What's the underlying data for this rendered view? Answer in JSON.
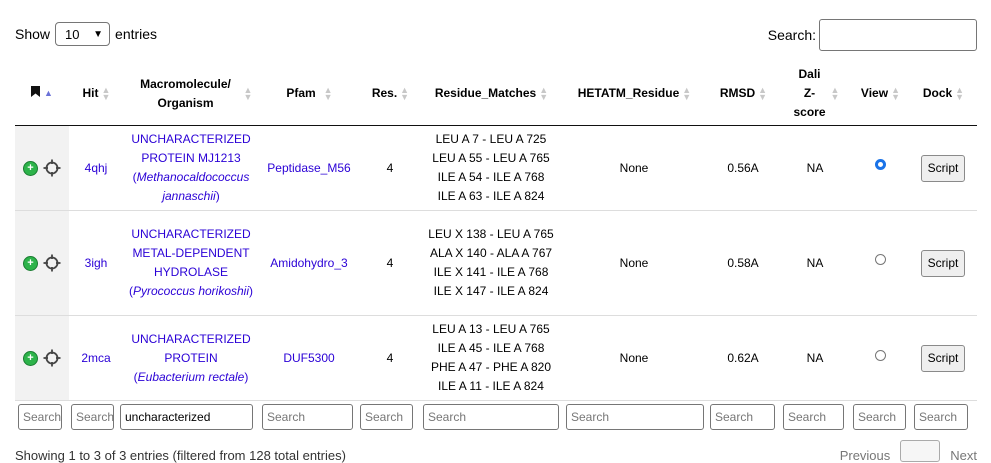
{
  "controls": {
    "show_label": "Show",
    "entries_value": "10",
    "entries_label": "entries",
    "search_label": "Search:",
    "search_value": ""
  },
  "headers": {
    "hit": "Hit",
    "macromolecule": "Macromolecule/ Organism",
    "pfam": "Pfam",
    "res": "Res.",
    "residue_matches": "Residue_Matches",
    "hetatm": "HETATM_Residue",
    "rmsd": "RMSD",
    "dali": "Dali Z- score",
    "view": "View",
    "dock": "Dock"
  },
  "rows": [
    {
      "hit": "4qhj",
      "macro_name": "UNCHARACTERIZED PROTEIN MJ1213",
      "organism": "Methanocaldococcus jannaschii",
      "pfam": "Peptidase_M56",
      "res": "4",
      "matches": [
        "LEU A 7 - LEU A 725",
        "LEU A 55 - LEU A 765",
        "ILE A 54 - ILE A 768",
        "ILE A 63 - ILE A 824"
      ],
      "hetatm": "None",
      "rmsd": "0.56A",
      "dali": "NA",
      "view_selected": true,
      "dock": "Script"
    },
    {
      "hit": "3igh",
      "macro_name": "UNCHARACTERIZED METAL-DEPENDENT HYDROLASE",
      "organism": "Pyrococcus horikoshii",
      "pfam": "Amidohydro_3",
      "res": "4",
      "matches": [
        "LEU X 138 - LEU A 765",
        "ALA X 140 - ALA A 767",
        "ILE X 141 - ILE A 768",
        "ILE X 147 - ILE A 824"
      ],
      "hetatm": "None",
      "rmsd": "0.58A",
      "dali": "NA",
      "view_selected": false,
      "dock": "Script"
    },
    {
      "hit": "2mca",
      "macro_name": "UNCHARACTERIZED PROTEIN",
      "organism": "Eubacterium rectale",
      "pfam": "DUF5300",
      "res": "4",
      "matches": [
        "LEU A 13 - LEU A 765",
        "ILE A 45 - ILE A 768",
        "PHE A 47 - PHE A 820",
        "ILE A 11 - ILE A 824"
      ],
      "hetatm": "None",
      "rmsd": "0.62A",
      "dali": "NA",
      "view_selected": false,
      "dock": "Script"
    }
  ],
  "column_filters": {
    "col0": "Search",
    "col1": "Search",
    "macromolecule_value": "uncharacterized",
    "pfam": "Search",
    "res": "Search",
    "residue_matches": "Search",
    "hetatm": "Search",
    "rmsd": "Search",
    "dali": "Search",
    "view": "Search",
    "dock": "Search"
  },
  "footer": {
    "info": "Showing 1 to 3 of 3 entries (filtered from 128 total entries)",
    "previous": "Previous",
    "next": "Next"
  }
}
